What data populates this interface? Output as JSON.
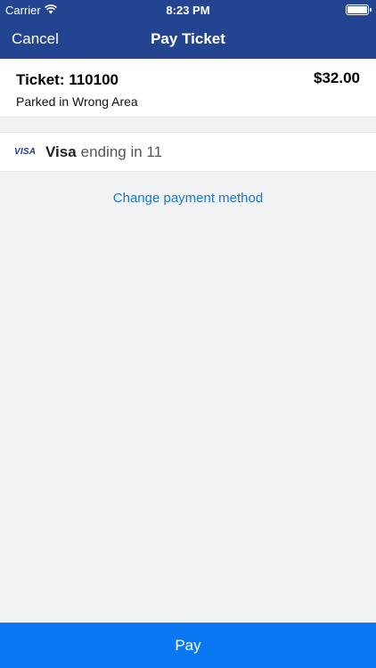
{
  "status_bar": {
    "carrier": "Carrier",
    "time": "8:23 PM"
  },
  "nav": {
    "cancel_label": "Cancel",
    "title": "Pay Ticket"
  },
  "ticket": {
    "title": "Ticket: 110100",
    "amount": "$32.00",
    "description": "Parked in Wrong Area"
  },
  "payment": {
    "logo_text": "VISA",
    "brand": "Visa",
    "detail": "ending in 11",
    "change_label": "Change payment method"
  },
  "footer": {
    "pay_label": "Pay"
  },
  "colors": {
    "header": "#234591",
    "link": "#1a7acb",
    "pay_button": "#0a78f3",
    "background": "#f1f2f4"
  }
}
